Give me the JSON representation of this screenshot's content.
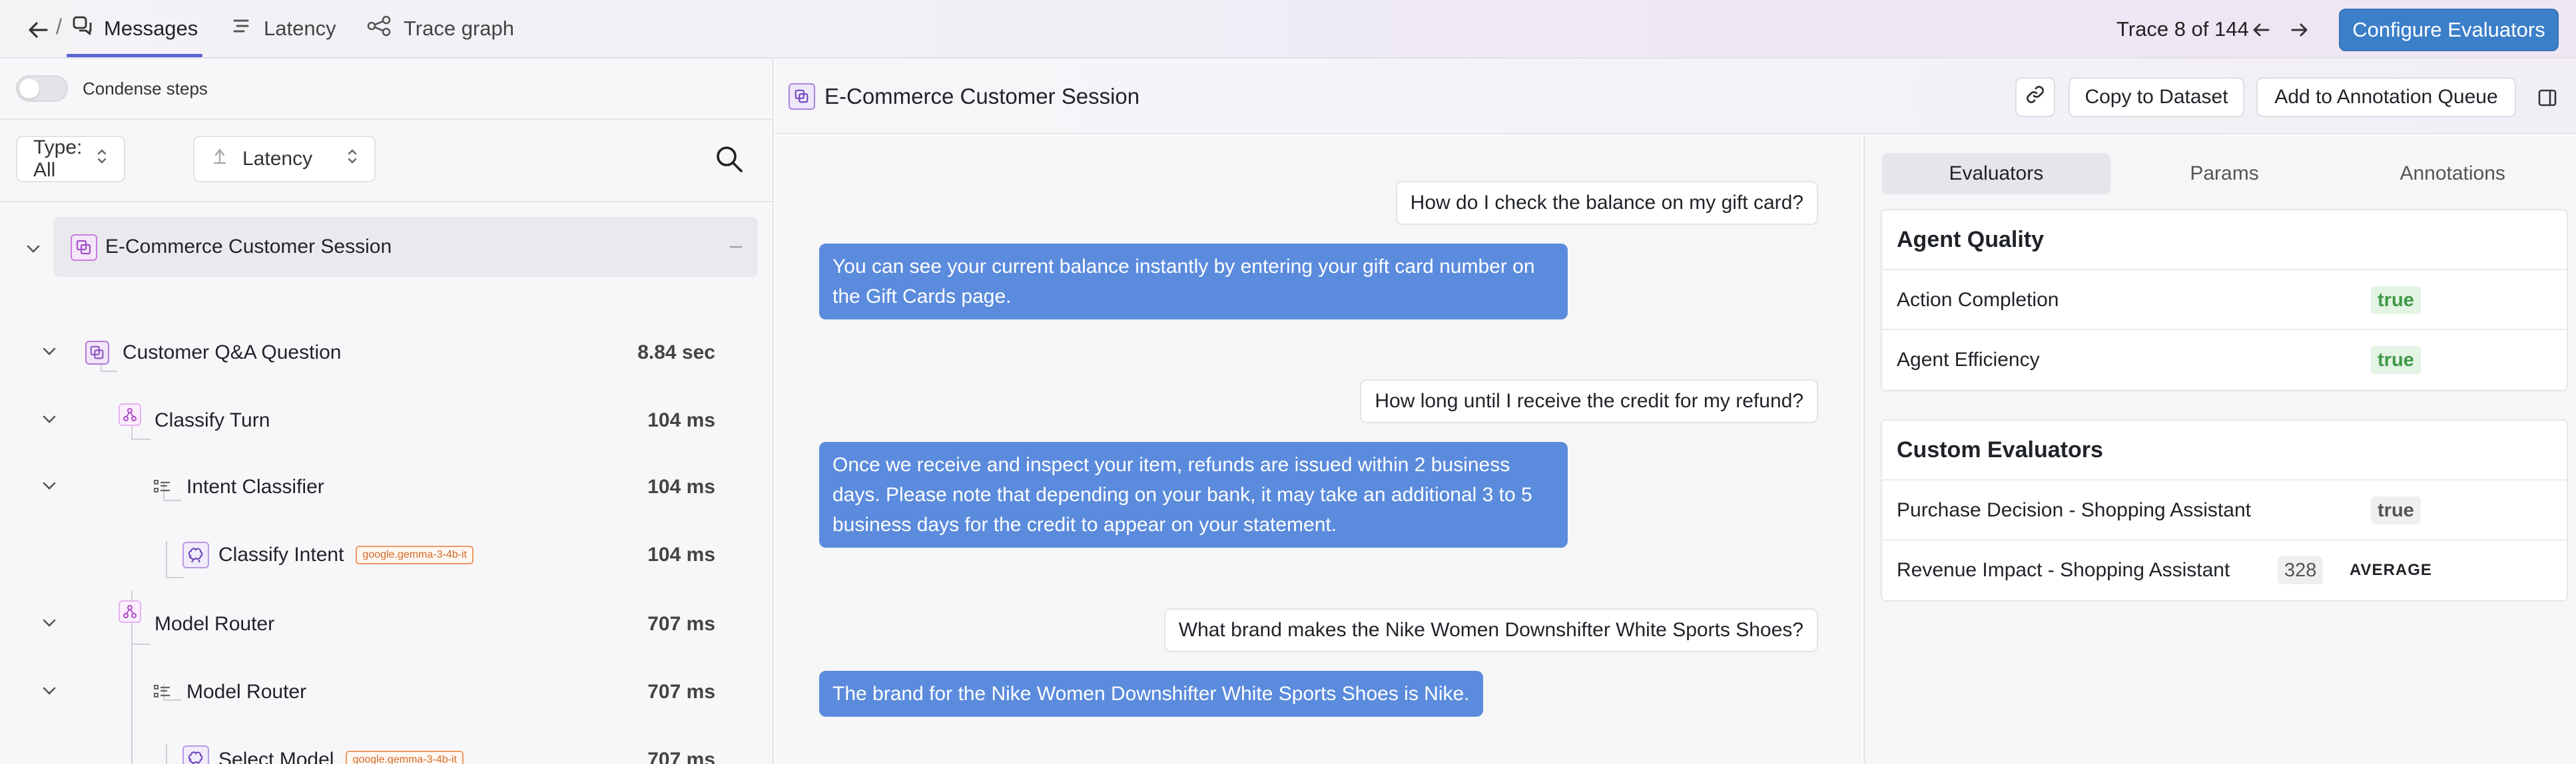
{
  "nav": {
    "tabs": [
      {
        "label": "Messages",
        "icon": "chat-bubbles-icon"
      },
      {
        "label": "Latency",
        "icon": "bars-icon"
      },
      {
        "label": "Trace graph",
        "icon": "graph-icon"
      }
    ],
    "trace_counter": "Trace 8 of 144",
    "configure_label": "Configure Evaluators"
  },
  "left": {
    "condense_label": "Condense steps",
    "type_filter": "Type: All",
    "sort_filter": "Latency",
    "tree": [
      {
        "label": "E-Commerce Customer Session",
        "time": "",
        "kind": "session"
      },
      {
        "label": "Customer Q&A Question",
        "time": "8.84 sec",
        "kind": "agent"
      },
      {
        "label": "Classify Turn",
        "time": "104 ms",
        "kind": "chain"
      },
      {
        "label": "Intent Classifier",
        "time": "104 ms",
        "kind": "tool"
      },
      {
        "label": "Classify Intent",
        "time": "104 ms",
        "kind": "llm",
        "model": "google.gemma-3-4b-it"
      },
      {
        "label": "Model Router",
        "time": "707 ms",
        "kind": "chain"
      },
      {
        "label": "Model Router",
        "time": "707 ms",
        "kind": "tool"
      },
      {
        "label": "Select Model",
        "time": "707 ms",
        "kind": "llm",
        "model": "google.gemma-3-4b-it"
      }
    ]
  },
  "main": {
    "title": "E-Commerce Customer Session",
    "copy_label": "Copy to Dataset",
    "annotation_label": "Add to Annotation Queue",
    "messages": [
      {
        "role": "user",
        "text": "How do I check the balance on my gift card?"
      },
      {
        "role": "assistant",
        "lines": [
          "You can see your current balance instantly by entering your gift card number on",
          "the Gift Cards page."
        ]
      },
      {
        "role": "user",
        "text": "How long until I receive the credit for my refund?"
      },
      {
        "role": "assistant",
        "lines": [
          "Once we receive and inspect your item, refunds are issued within 2 business",
          "days. Please note that depending on your bank, it may take an additional 3 to 5",
          "business days for the credit to appear on your statement."
        ]
      },
      {
        "role": "user",
        "text": "What brand makes the Nike Women Downshifter White Sports Shoes?"
      },
      {
        "role": "assistant",
        "lines": [
          "The brand for the Nike Women Downshifter White Sports Shoes is Nike."
        ]
      }
    ]
  },
  "evaluators": {
    "tabs": [
      "Evaluators",
      "Params",
      "Annotations"
    ],
    "agent_quality": {
      "title": "Agent Quality",
      "rows": [
        {
          "name": "Action Completion",
          "value": "true"
        },
        {
          "name": "Agent Efficiency",
          "value": "true"
        }
      ]
    },
    "custom": {
      "title": "Custom Evaluators",
      "rows": [
        {
          "name": "Purchase Decision - Shopping Assistant",
          "value": "true"
        },
        {
          "name": "Revenue Impact - Shopping Assistant",
          "value": "328",
          "tag": "AVERAGE"
        }
      ]
    }
  },
  "colors": {
    "accent": "#5b63d3",
    "primary_button": "#3c7fc9",
    "bot_bubble": "#5b8bdc",
    "true_green": "#3f9a48",
    "node_purple": "#a24fc9",
    "model_badge": "#d26a28"
  }
}
